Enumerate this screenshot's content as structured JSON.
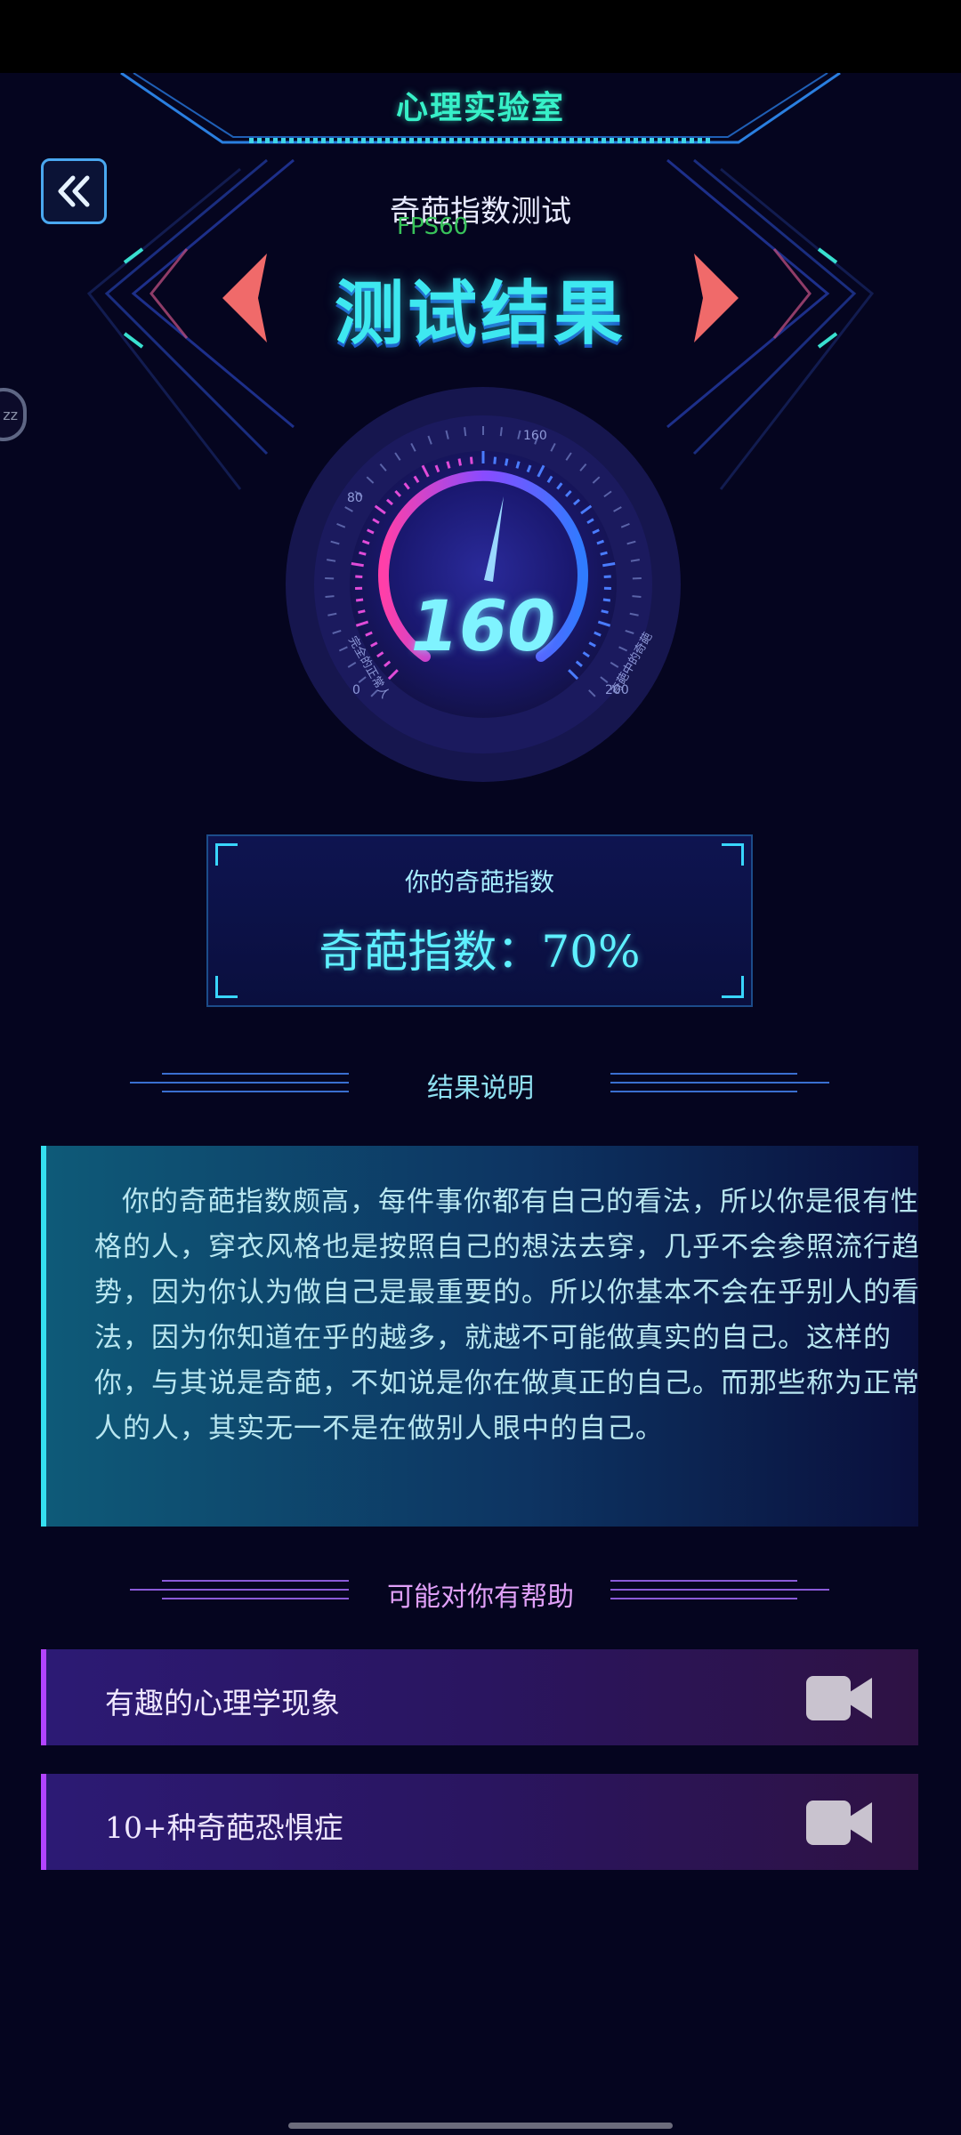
{
  "header": {
    "title": "心理实验室",
    "back_icon": "double-chevron-left-icon"
  },
  "side_floating": {
    "label": "zz"
  },
  "test": {
    "name": "奇葩指数测试",
    "fps_overlay": "FPS60",
    "result_title": "测试结果"
  },
  "gauge": {
    "value": "160",
    "value_fraction": 0.8,
    "tick_labels": [
      "0",
      "80",
      "160",
      "200"
    ],
    "left_caption": "完全的正常人",
    "right_caption": "奇葩中的奇葩"
  },
  "score": {
    "label": "你的奇葩指数",
    "text": "奇葩指数：70%"
  },
  "sections": {
    "result_heading": "结果说明",
    "help_heading": "可能对你有帮助"
  },
  "description": "你的奇葩指数颇高，每件事你都有自己的看法，所以你是很有性格的人，穿衣风格也是按照自己的想法去穿，几乎不会参照流行趋势，因为你认为做自己是最重要的。所以你基本不会在乎别人的看法，因为你知道在乎的越多，就越不可能做真实的自己。这样的你，与其说是奇葩，不如说是你在做真正的自己。而那些称为正常人的人，其实无一不是在做别人眼中的自己。",
  "help_items": [
    {
      "label": "有趣的心理学现象",
      "icon": "video-camera-icon"
    },
    {
      "label": "10+种奇葩恐惧症",
      "icon": "video-camera-icon"
    }
  ],
  "colors": {
    "background": "#05051f",
    "accent_cyan": "#3ee8f0",
    "accent_purple": "#b244ff",
    "header_green": "#37f0c8"
  }
}
